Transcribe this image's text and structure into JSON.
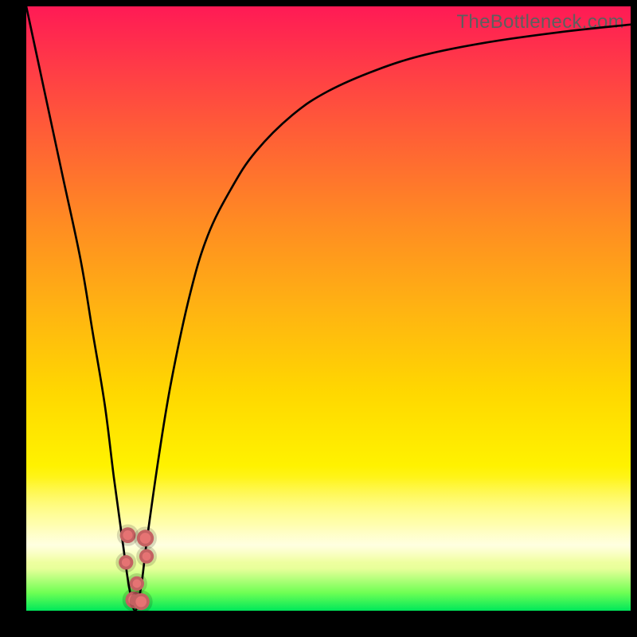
{
  "watermark": "TheBottleneck.com",
  "colors": {
    "curve": "#000000",
    "marker": "#e57373"
  },
  "chart_data": {
    "type": "line",
    "title": "",
    "xlabel": "",
    "ylabel": "",
    "xlim": [
      0,
      100
    ],
    "ylim": [
      0,
      100
    ],
    "note": "Axes are unlabeled in the source image; values are normalized 0–100 percent of the visible plot area. Y is plotted with 0 at the bottom (good/green) and 100 at the top (bad/red).",
    "series": [
      {
        "name": "bottleneck-curve",
        "x": [
          0,
          3,
          6,
          9,
          11,
          13,
          14.5,
          16,
          17,
          18,
          19,
          20,
          22,
          24,
          27,
          30,
          34,
          38,
          44,
          50,
          58,
          66,
          76,
          88,
          100
        ],
        "y": [
          100,
          86,
          72,
          58,
          46,
          34,
          22,
          11,
          4,
          0,
          4,
          12,
          26,
          38,
          52,
          62,
          70,
          76,
          82,
          86,
          89.5,
          92,
          94,
          95.7,
          97
        ]
      }
    ],
    "markers": [
      {
        "x": 16.8,
        "y": 12.5,
        "r": 1.3
      },
      {
        "x": 16.5,
        "y": 8.0,
        "r": 1.2
      },
      {
        "x": 17.8,
        "y": 1.8,
        "r": 1.4
      },
      {
        "x": 18.3,
        "y": 4.5,
        "r": 1.2
      },
      {
        "x": 19.7,
        "y": 12.0,
        "r": 1.4
      },
      {
        "x": 19.9,
        "y": 9.0,
        "r": 1.2
      },
      {
        "x": 19.0,
        "y": 1.5,
        "r": 1.4
      }
    ]
  }
}
